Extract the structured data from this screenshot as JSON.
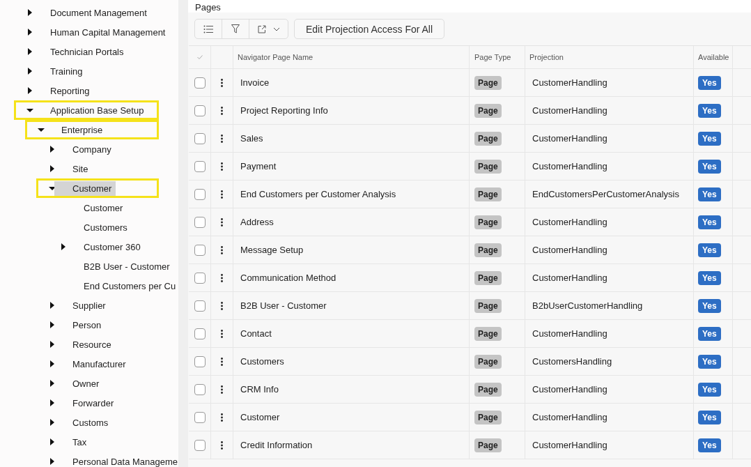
{
  "navigator": {
    "items": [
      {
        "label": "Document Management",
        "expanded": false,
        "selected": false,
        "highlighted": false
      },
      {
        "label": "Human Capital Management",
        "expanded": false,
        "selected": false,
        "highlighted": false
      },
      {
        "label": "Technician Portals",
        "expanded": false,
        "selected": false,
        "highlighted": false
      },
      {
        "label": "Training",
        "expanded": false,
        "selected": false,
        "highlighted": false
      },
      {
        "label": "Reporting",
        "expanded": false,
        "selected": false,
        "highlighted": false
      },
      {
        "label": "Application Base Setup",
        "expanded": true,
        "selected": false,
        "highlighted": true,
        "children": [
          {
            "label": "Enterprise",
            "expanded": true,
            "selected": false,
            "highlighted": true,
            "children": [
              {
                "label": "Company",
                "expanded": false,
                "selected": false,
                "highlighted": false
              },
              {
                "label": "Site",
                "expanded": false,
                "selected": false,
                "highlighted": false
              },
              {
                "label": "Customer",
                "expanded": true,
                "selected": true,
                "highlighted": true,
                "children": [
                  {
                    "label": "Customer",
                    "selected": false,
                    "highlighted": false
                  },
                  {
                    "label": "Customers",
                    "selected": false,
                    "highlighted": false
                  },
                  {
                    "label": "Customer 360",
                    "expanded": false,
                    "selected": false,
                    "highlighted": false
                  },
                  {
                    "label": "B2B User - Customer",
                    "selected": false,
                    "highlighted": false
                  },
                  {
                    "label": "End Customers per Cu",
                    "selected": false,
                    "highlighted": false
                  }
                ]
              },
              {
                "label": "Supplier",
                "expanded": false,
                "selected": false,
                "highlighted": false
              },
              {
                "label": "Person",
                "expanded": false,
                "selected": false,
                "highlighted": false
              },
              {
                "label": "Resource",
                "expanded": false,
                "selected": false,
                "highlighted": false
              },
              {
                "label": "Manufacturer",
                "expanded": false,
                "selected": false,
                "highlighted": false
              },
              {
                "label": "Owner",
                "expanded": false,
                "selected": false,
                "highlighted": false
              },
              {
                "label": "Forwarder",
                "expanded": false,
                "selected": false,
                "highlighted": false
              },
              {
                "label": "Customs",
                "expanded": false,
                "selected": false,
                "highlighted": false
              },
              {
                "label": "Tax",
                "expanded": false,
                "selected": false,
                "highlighted": false
              },
              {
                "label": "Personal Data Manageme",
                "expanded": false,
                "selected": false,
                "highlighted": false
              }
            ]
          }
        ]
      }
    ]
  },
  "panel": {
    "title": "Pages",
    "toolbar": {
      "action_button": "Edit Projection Access For All"
    },
    "table": {
      "columns": [
        "Navigator Page Name",
        "Page Type",
        "Projection",
        "Available"
      ],
      "rows": [
        {
          "checked": false,
          "name": "Invoice",
          "type": "Page",
          "projection": "CustomerHandling",
          "available": "Yes"
        },
        {
          "checked": false,
          "name": "Project Reporting Info",
          "type": "Page",
          "projection": "CustomerHandling",
          "available": "Yes"
        },
        {
          "checked": false,
          "name": "Sales",
          "type": "Page",
          "projection": "CustomerHandling",
          "available": "Yes"
        },
        {
          "checked": false,
          "name": "Payment",
          "type": "Page",
          "projection": "CustomerHandling",
          "available": "Yes"
        },
        {
          "checked": false,
          "name": "End Customers per Customer Analysis",
          "type": "Page",
          "projection": "EndCustomersPerCustomerAnalysis",
          "available": "Yes"
        },
        {
          "checked": false,
          "name": "Address",
          "type": "Page",
          "projection": "CustomerHandling",
          "available": "Yes"
        },
        {
          "checked": false,
          "name": "Message Setup",
          "type": "Page",
          "projection": "CustomerHandling",
          "available": "Yes"
        },
        {
          "checked": false,
          "name": "Communication Method",
          "type": "Page",
          "projection": "CustomerHandling",
          "available": "Yes"
        },
        {
          "checked": false,
          "name": "B2B User - Customer",
          "type": "Page",
          "projection": "B2bUserCustomerHandling",
          "available": "Yes"
        },
        {
          "checked": false,
          "name": "Contact",
          "type": "Page",
          "projection": "CustomerHandling",
          "available": "Yes"
        },
        {
          "checked": false,
          "name": "Customers",
          "type": "Page",
          "projection": "CustomersHandling",
          "available": "Yes"
        },
        {
          "checked": false,
          "name": "CRM Info",
          "type": "Page",
          "projection": "CustomerHandling",
          "available": "Yes"
        },
        {
          "checked": false,
          "name": "Customer",
          "type": "Page",
          "projection": "CustomerHandling",
          "available": "Yes"
        },
        {
          "checked": false,
          "name": "Credit Information",
          "type": "Page",
          "projection": "CustomerHandling",
          "available": "Yes"
        }
      ]
    }
  }
}
